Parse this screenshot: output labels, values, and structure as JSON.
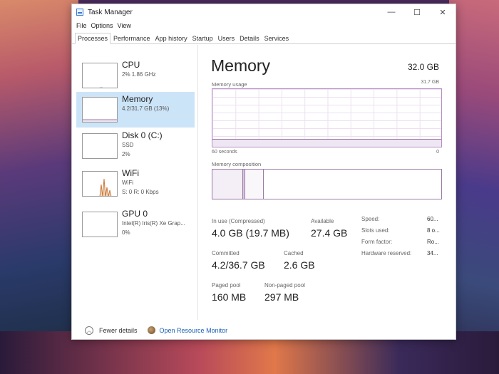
{
  "window": {
    "title": "Task Manager",
    "controls": [
      "—",
      "☐",
      "✕"
    ]
  },
  "menu": [
    "File",
    "Options",
    "View"
  ],
  "tabs": [
    "Processes",
    "Performance",
    "App history",
    "Startup",
    "Users",
    "Details",
    "Services"
  ],
  "active_tab": "Processes",
  "resources": [
    {
      "title": "CPU",
      "sub1": "2% 1.86 GHz",
      "sub2": "",
      "sub3": "",
      "active": false
    },
    {
      "title": "Memory",
      "sub1": "4.2/31.7 GB (13%)",
      "sub2": "",
      "sub3": "",
      "active": true
    },
    {
      "title": "Disk 0 (C:)",
      "sub1": "SSD",
      "sub2": "2%",
      "sub3": "",
      "active": false
    },
    {
      "title": "WiFi",
      "sub1": "WiFi",
      "sub2": "S: 0 R: 0 Kbps",
      "sub3": "",
      "active": false
    },
    {
      "title": "GPU 0",
      "sub1": "Intel(R) Iris(R) Xe Grap...",
      "sub2": "0%",
      "sub3": "",
      "active": false
    }
  ],
  "memory": {
    "title": "Memory",
    "total": "32.0 GB",
    "usage_label": "Memory usage",
    "usage_max": "31.7 GB",
    "graph_left": "60 seconds",
    "graph_right": "0",
    "usage_fraction": 0.13,
    "composition_label": "Memory composition",
    "composition": [
      {
        "name": "in-use",
        "fraction": 0.135,
        "color": "#f4eef6"
      },
      {
        "name": "modified",
        "fraction": 0.008,
        "color": "#d8c8de"
      },
      {
        "name": "standby",
        "fraction": 0.082,
        "color": "#faf7fb"
      },
      {
        "name": "free",
        "fraction": 0.775,
        "color": "#ffffff"
      }
    ],
    "stats": {
      "in_use_label": "In use (Compressed)",
      "in_use_value": "4.0 GB (19.7 MB)",
      "available_label": "Available",
      "available_value": "27.4 GB",
      "committed_label": "Committed",
      "committed_value": "4.2/36.7 GB",
      "cached_label": "Cached",
      "cached_value": "2.6 GB",
      "paged_label": "Paged pool",
      "paged_value": "160 MB",
      "nonpaged_label": "Non-paged pool",
      "nonpaged_value": "297 MB"
    },
    "specs": [
      {
        "key": "Speed:",
        "value": "60..."
      },
      {
        "key": "Slots used:",
        "value": "8 o..."
      },
      {
        "key": "Form factor:",
        "value": "Ro..."
      },
      {
        "key": "Hardware reserved:",
        "value": "34..."
      }
    ]
  },
  "footer": {
    "fewer_details": "Fewer details",
    "open_resource_monitor": "Open Resource Monitor"
  },
  "colors": {
    "accent_purple": "#9a7aa6",
    "selection": "#cce4f7",
    "link": "#1a5fb4"
  }
}
